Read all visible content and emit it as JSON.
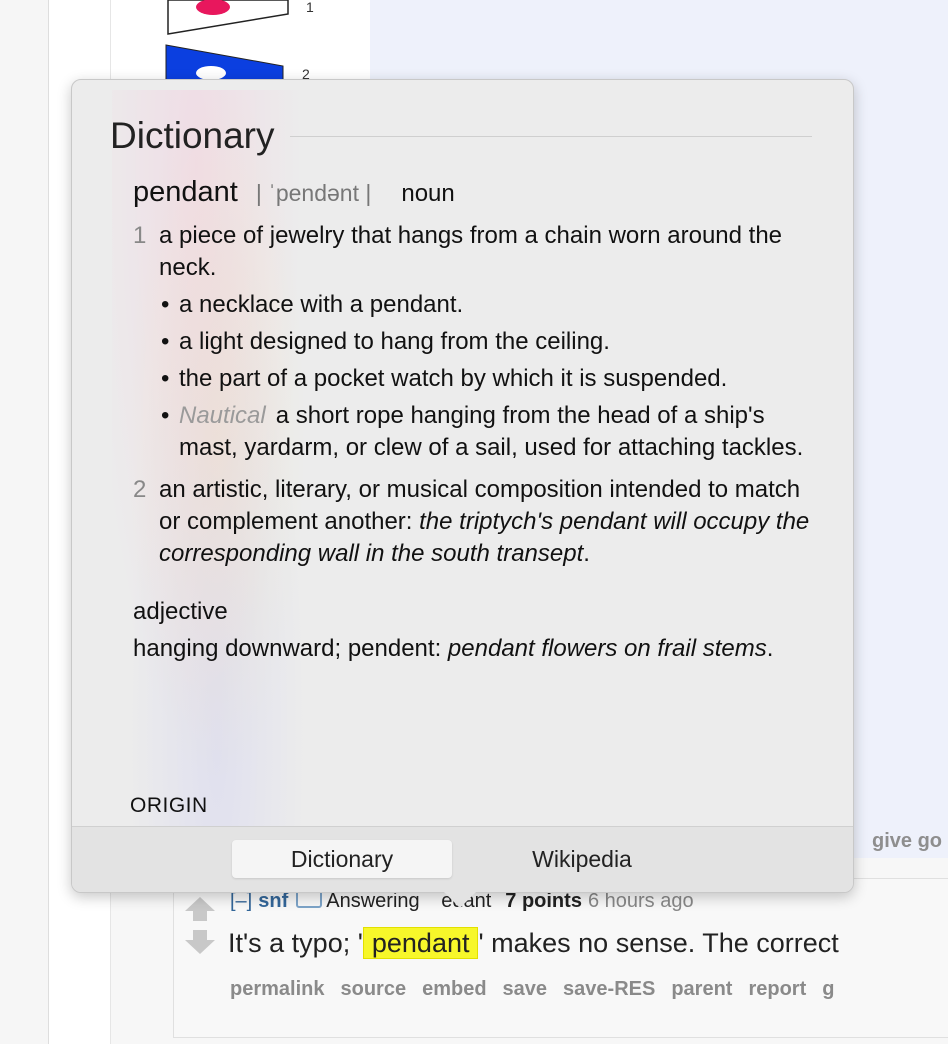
{
  "background": {
    "thumb_labels": [
      "1",
      "2"
    ],
    "give_text": "give go"
  },
  "comment": {
    "collapse": "[–]",
    "author": "snf",
    "answering": "Answering",
    "answering_target": "edant",
    "points": "7 points",
    "time": "6 hours ago",
    "body_before": "It's a typo; '",
    "highlight": "pendant",
    "body_after": "' makes no sense. The correct",
    "actions": [
      "permalink",
      "source",
      "embed",
      "save",
      "save-RES",
      "parent",
      "report",
      "g"
    ]
  },
  "dictionary": {
    "title": "Dictionary",
    "headword": "pendant",
    "pronunciation": "| ˈpendənt |",
    "pos_noun": "noun",
    "senses": [
      {
        "num": "1",
        "text": "a piece of jewelry that hangs from a chain worn around the neck.",
        "subs": [
          {
            "label": "",
            "text": "a necklace with a pendant."
          },
          {
            "label": "",
            "text": "a light designed to hang from the ceiling."
          },
          {
            "label": "",
            "text": "the part of a pocket watch by which it is suspended."
          },
          {
            "label": "Nautical",
            "text": "a short rope hanging from the head of a ship's mast, yardarm, or clew of a sail, used for attaching tackles."
          }
        ]
      },
      {
        "num": "2",
        "text": "an artistic, literary, or musical composition intended to match or complement another:",
        "example": "the triptych's pendant will occupy the corresponding wall in the south transept",
        "end": "."
      }
    ],
    "pos_adj": "adjective",
    "adj_text": "hanging downward; pendent:",
    "adj_example": "pendant flowers on frail stems",
    "adj_end": ".",
    "origin": "ORIGIN",
    "tabs": [
      "Dictionary",
      "Wikipedia"
    ]
  },
  "colors": {
    "highlight": "#f7f72a",
    "link_blue": "#336699",
    "popover_bg": "#ececec",
    "thumb_red": "#e8175d",
    "thumb_blue": "#0b3fe0"
  }
}
